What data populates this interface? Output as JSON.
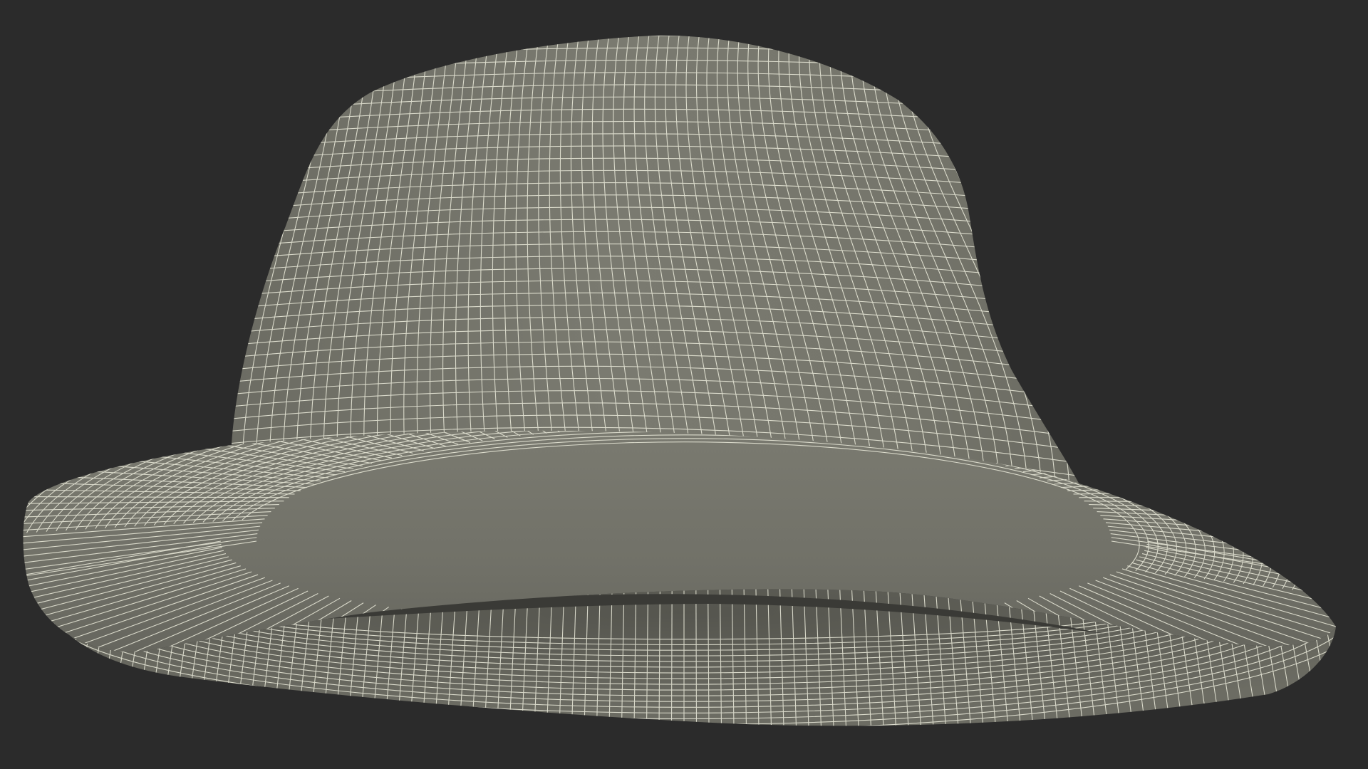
{
  "scene": {
    "subject_icon": "wireframe-hat-model",
    "colors": {
      "background": "#2b2b2b",
      "surface": "#74746a",
      "surface_shadow": "#5e5e56",
      "surface_light": "#84847a",
      "wire": "#e6e6d6",
      "inner_dark": "#3a3a36"
    }
  }
}
